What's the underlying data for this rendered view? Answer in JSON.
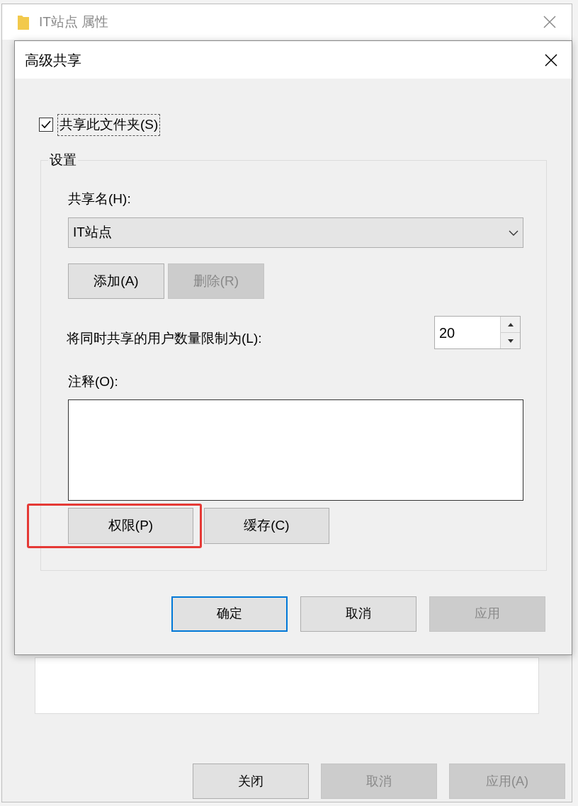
{
  "background_window": {
    "title": "IT站点 属性",
    "buttons": [
      {
        "label": "关闭",
        "disabled": false
      },
      {
        "label": "取消",
        "disabled": true
      },
      {
        "label": "应用(A)",
        "disabled": true
      }
    ]
  },
  "dialog": {
    "title": "高级共享",
    "share_checkbox": {
      "label": "共享此文件夹(S)",
      "checked": true
    },
    "settings": {
      "title": "设置",
      "share_name_label": "共享名(H):",
      "share_name_value": "IT站点",
      "name_buttons": [
        {
          "label": "添加(A)",
          "disabled": false
        },
        {
          "label": "删除(R)",
          "disabled": true
        }
      ],
      "limit_label": "将同时共享的用户数量限制为(L):",
      "limit_value": "20",
      "comment_label": "注释(O):",
      "action_buttons": [
        {
          "label": "权限(P)",
          "highlighted": true
        },
        {
          "label": "缓存(C)",
          "highlighted": false
        }
      ]
    },
    "buttons": [
      {
        "label": "确定",
        "default": true,
        "disabled": false
      },
      {
        "label": "取消",
        "default": false,
        "disabled": false
      },
      {
        "label": "应用",
        "default": false,
        "disabled": true
      }
    ]
  }
}
